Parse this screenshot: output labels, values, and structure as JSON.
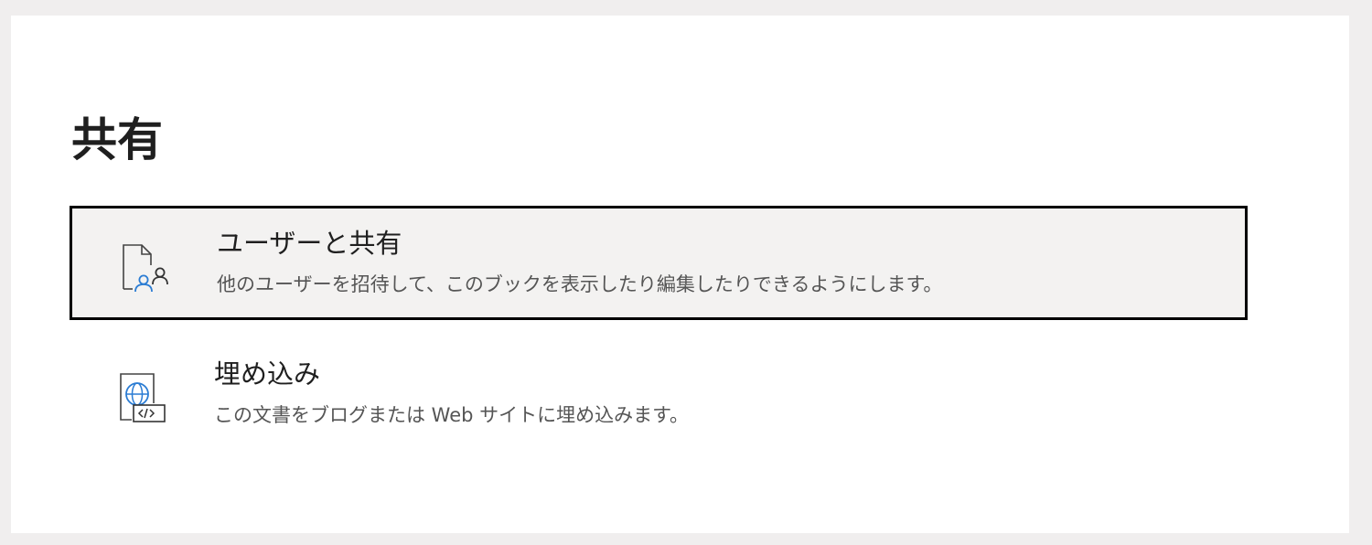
{
  "page": {
    "title": "共有"
  },
  "options": [
    {
      "label": "ユーザーと共有",
      "description": "他のユーザーを招待して、このブックを表示したり編集したりできるようにします。",
      "icon": "share-with-people-icon",
      "selected": true
    },
    {
      "label": "埋め込み",
      "description": "この文書をブログまたは Web サイトに埋め込みます。",
      "icon": "embed-icon",
      "selected": false
    }
  ],
  "colors": {
    "accent_blue": "#2b7cd3",
    "selected_background": "#f3f2f1",
    "focus_border": "#000000"
  }
}
